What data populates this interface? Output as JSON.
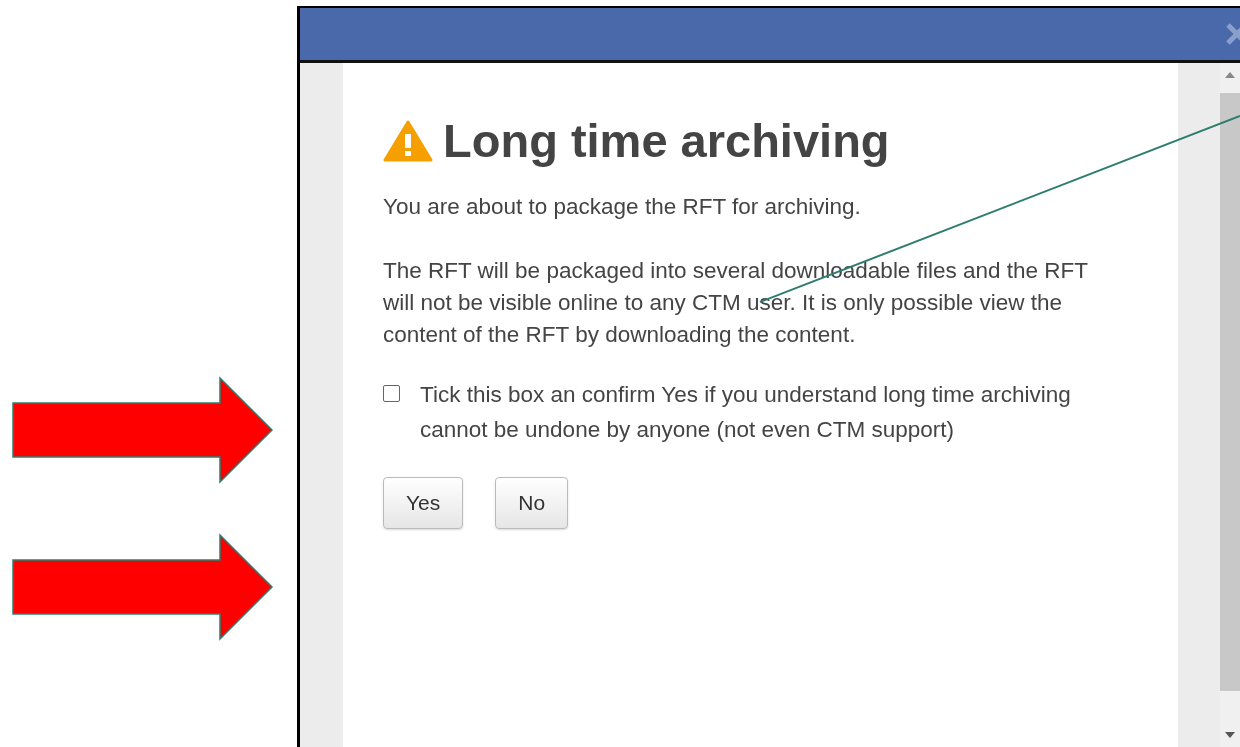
{
  "dialog": {
    "title": "Long time archiving",
    "paragraphs": [
      "You are about to package the RFT for archiving.",
      "The RFT will be packaged into several downloadable files and the RFT will not be visible online to any CTM user. It is only possible view the content of the RFT by downloading the content."
    ],
    "confirm_checkbox": {
      "label": "Tick this box an confirm Yes if you understand long time archiving cannot be undone by anyone (not even CTM support)",
      "checked": false
    },
    "buttons": [
      "Yes",
      "No"
    ]
  }
}
